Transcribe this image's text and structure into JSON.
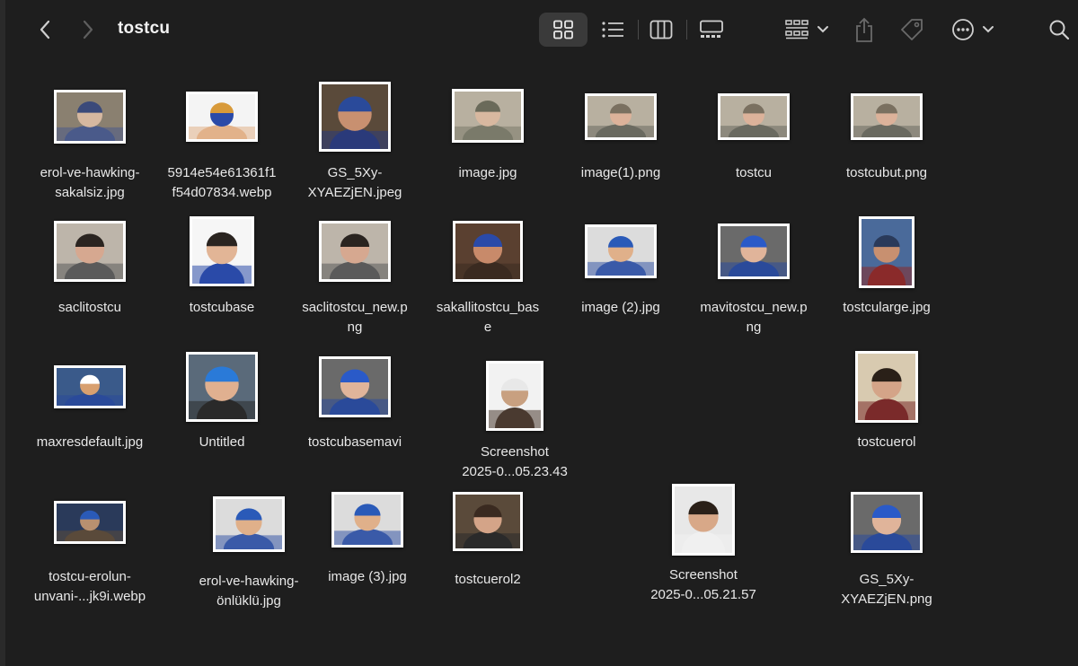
{
  "window": {
    "title": "tostcu",
    "icons": {
      "back": "chevron-left-icon",
      "forward": "chevron-right-icon",
      "icon_view": "grid-icon",
      "list_view": "list-icon",
      "column_view": "columns-icon",
      "gallery_view": "gallery-icon",
      "group": "group-icon",
      "share": "share-icon",
      "tag": "tag-icon",
      "more": "ellipsis-circle-icon",
      "search": "search-icon"
    }
  },
  "files": [
    {
      "name": "erol-ve-hawking-\nsakalsiz.jpg",
      "scene": "two-men-living-room"
    },
    {
      "name": "5914e54e61361f1\nf54d07834.webp",
      "scene": "man-holding-bread"
    },
    {
      "name": "GS_5Xy-\nXYAEZjEN.jpeg",
      "scene": "chef-blue-cap-mug"
    },
    {
      "name": "image.jpg",
      "scene": "two-men-eating"
    },
    {
      "name": "image(1).png",
      "scene": "bald-man-closeup"
    },
    {
      "name": "tostcu",
      "scene": "bald-man-closeup"
    },
    {
      "name": "tostcubut.png",
      "scene": "bald-man-closeup"
    },
    {
      "name": "saclitostcu",
      "scene": "man-with-hair"
    },
    {
      "name": "tostcubase",
      "scene": "man-blue-shirt-white-bg"
    },
    {
      "name": "saclitostcu_new.p\nng",
      "scene": "man-with-hair"
    },
    {
      "name": "sakallitostcu_bas\ne",
      "scene": "bearded-man-blue-cap"
    },
    {
      "name": "image (2).jpg",
      "scene": "two-men-toast"
    },
    {
      "name": "mavitostcu_new.p\nng",
      "scene": "man-blue-cap"
    },
    {
      "name": "tostcularge.jpg",
      "scene": "man-blue-sign"
    },
    {
      "name": "maxresdefault.jpg",
      "scene": "toast-shop"
    },
    {
      "name": "Untitled",
      "scene": "man-blue-cap-smiling"
    },
    {
      "name": "tostcubasemavi",
      "scene": "man-blue-cap"
    },
    {
      "name": "Screenshot\n2025-0...05.23.43",
      "scene": "man-white-cap"
    },
    {
      "name": "tostcuerol",
      "scene": "bearded-man-red"
    },
    {
      "name": "tostcu-erolun-\nunvani-...jk9i.webp",
      "scene": "toast-shop-counter"
    },
    {
      "name": "erol-ve-hawking-\nönlüklü.jpg",
      "scene": "two-men-toast"
    },
    {
      "name": "image (3).jpg",
      "scene": "two-men-toast"
    },
    {
      "name": "tostcuerol2",
      "scene": "bearded-man-closeup"
    },
    {
      "name": "Screenshot\n2025-0...05.21.57",
      "scene": "smiling-bearded-man"
    },
    {
      "name": "GS_5Xy-\nXYAEZjEN.png",
      "scene": "man-blue-cap"
    }
  ]
}
